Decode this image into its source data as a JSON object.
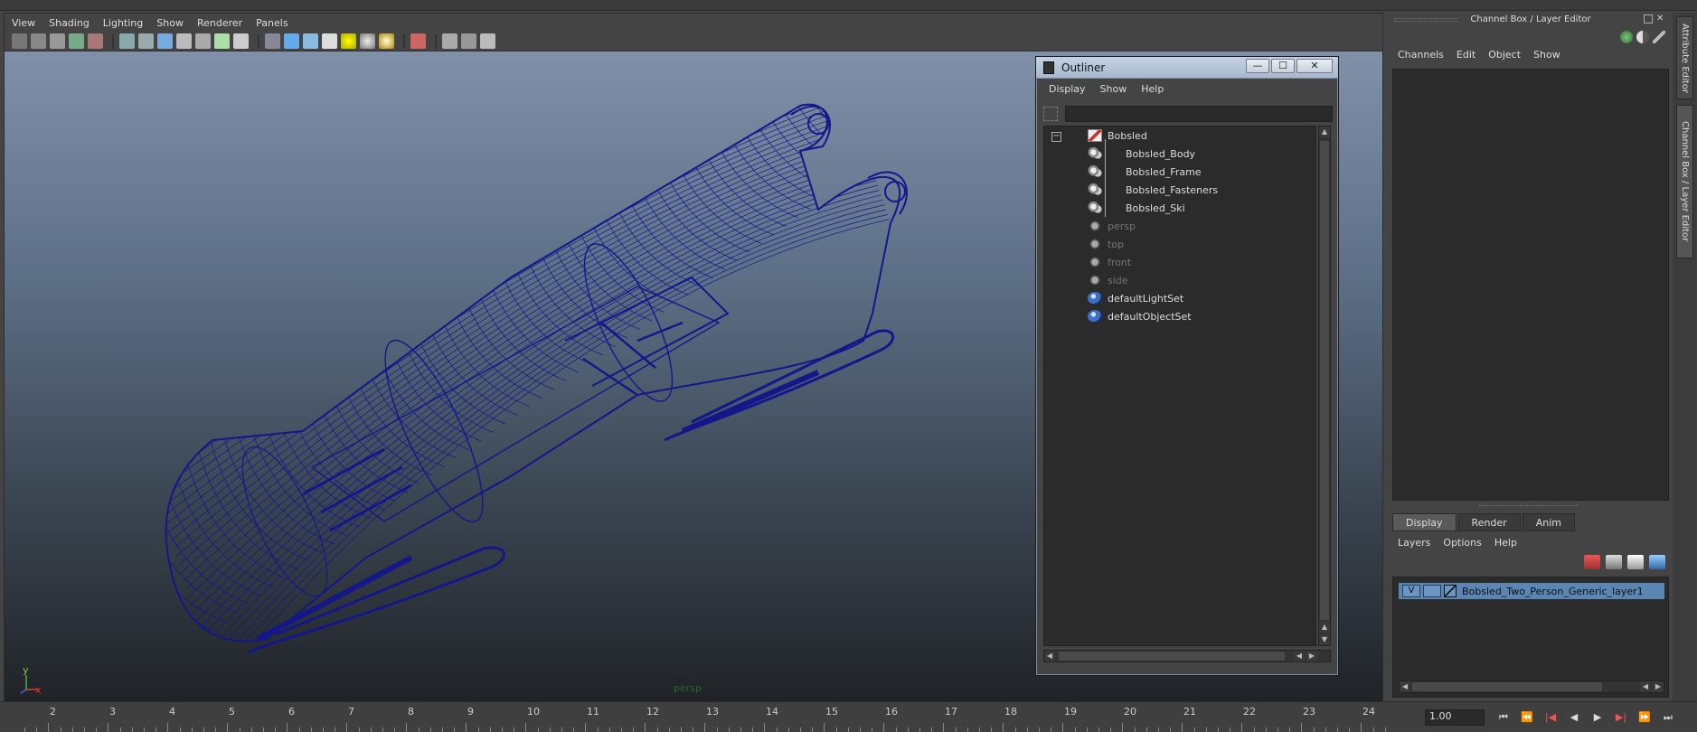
{
  "viewport": {
    "menu": [
      "View",
      "Shading",
      "Lighting",
      "Show",
      "Renderer",
      "Panels"
    ],
    "camera_label": "persp",
    "axis_y": "y",
    "axis_x": "x"
  },
  "outliner": {
    "title": "Outliner",
    "menu": [
      "Display",
      "Show",
      "Help"
    ],
    "filter_placeholder": "",
    "items": [
      {
        "label": "Bobsled",
        "icon": "group-transform-icon"
      },
      {
        "label": "Bobsled_Body",
        "icon": "mesh-object-icon"
      },
      {
        "label": "Bobsled_Frame",
        "icon": "mesh-object-icon"
      },
      {
        "label": "Bobsled_Fasteners",
        "icon": "mesh-object-icon"
      },
      {
        "label": "Bobsled_Ski",
        "icon": "mesh-object-icon"
      },
      {
        "label": "persp",
        "icon": "camera-icon"
      },
      {
        "label": "top",
        "icon": "camera-icon"
      },
      {
        "label": "front",
        "icon": "camera-icon"
      },
      {
        "label": "side",
        "icon": "camera-icon"
      },
      {
        "label": "defaultLightSet",
        "icon": "set-icon"
      },
      {
        "label": "defaultObjectSet",
        "icon": "set-icon"
      }
    ],
    "minimize": "—",
    "maximize": "☐",
    "close": "✕",
    "collapse": "−"
  },
  "right_panel": {
    "title": "Channel Box / Layer Editor",
    "channel_menu": [
      "Channels",
      "Edit",
      "Object",
      "Show"
    ],
    "tabs": [
      "Display",
      "Render",
      "Anim"
    ],
    "layer_menu": [
      "Layers",
      "Options",
      "Help"
    ],
    "layer": {
      "visible": "V",
      "name": "Bobsled_Two_Person_Generic_layer1"
    },
    "vertical_tabs": [
      "Attribute Editor",
      "Channel Box / Layer Editor"
    ]
  },
  "timeline": {
    "ticks": [
      "2",
      "3",
      "4",
      "5",
      "6",
      "7",
      "8",
      "9",
      "10",
      "11",
      "12",
      "13",
      "14",
      "15",
      "16",
      "17",
      "18",
      "19",
      "20",
      "21",
      "22",
      "23",
      "24"
    ],
    "current_frame": "1.00",
    "controls": [
      "⏮",
      "⏪",
      "|◀",
      "◀",
      "▶",
      "▶|",
      "⏩",
      "⏭"
    ]
  },
  "colors": {
    "wireframe": "#14178a",
    "layer_selected": "#5b86b3",
    "camera_label": "#1f6b35"
  }
}
